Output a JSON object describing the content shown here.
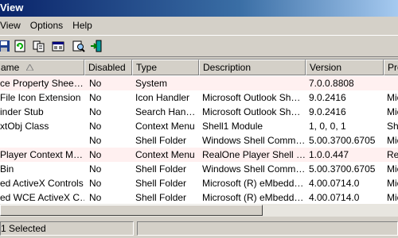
{
  "window": {
    "title": "View"
  },
  "menu": [
    "View",
    "Options",
    "Help"
  ],
  "toolbar": {
    "buttons": [
      "save-icon",
      "refresh-icon",
      "copy-icon",
      "properties-icon",
      "find-icon",
      "exit-icon"
    ]
  },
  "columns": [
    "ame",
    "Disabled",
    "Type",
    "Description",
    "Version",
    "Pro"
  ],
  "rows": [
    {
      "name": "ce Property Shee…",
      "disabled": "No",
      "type": "System",
      "description": "",
      "version": "7.0.0.8808",
      "product": ""
    },
    {
      "name": "File Icon Extension",
      "disabled": "No",
      "type": "Icon Handler",
      "description": "Microsoft Outlook Sh…",
      "version": "9.0.2416",
      "product": "Mic"
    },
    {
      "name": "inder Stub",
      "disabled": "No",
      "type": "Search Han…",
      "description": "Microsoft Outlook Sh…",
      "version": "9.0.2416",
      "product": "Mic"
    },
    {
      "name": "xtObj Class",
      "disabled": "No",
      "type": "Context Menu",
      "description": "Shell1 Module",
      "version": "1, 0, 0, 1",
      "product": "She"
    },
    {
      "name": "",
      "disabled": "No",
      "type": "Shell Folder",
      "description": "Windows Shell Comm…",
      "version": "5.00.3700.6705",
      "product": "Mic"
    },
    {
      "name": "Player Context M…",
      "disabled": "No",
      "type": "Context Menu",
      "description": "RealOne Player Shell …",
      "version": "1.0.0.447",
      "product": "Rea"
    },
    {
      "name": "Bin",
      "disabled": "No",
      "type": "Shell Folder",
      "description": "Windows Shell Comm…",
      "version": "5.00.3700.6705",
      "product": "Mic"
    },
    {
      "name": "ed ActiveX Controls",
      "disabled": "No",
      "type": "Shell Folder",
      "description": "Microsoft (R) eMbedd…",
      "version": "4.00.0714.0",
      "product": "Mic"
    },
    {
      "name": "ed WCE ActiveX C…",
      "disabled": "No",
      "type": "Shell Folder",
      "description": "Microsoft (R) eMbedd…",
      "version": "4.00.0714.0",
      "product": "Mic"
    }
  ],
  "status": {
    "selected": "1 Selected"
  }
}
